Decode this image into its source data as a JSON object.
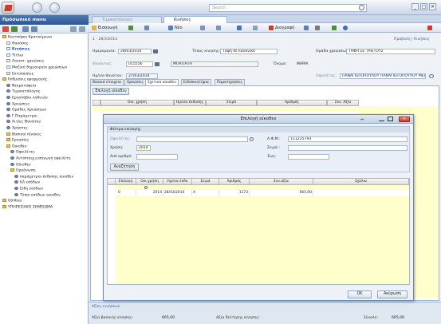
{
  "topbar": {
    "search_placeholder": "Search",
    "win_min": "_",
    "win_max": "□",
    "win_close": "✕"
  },
  "left_panel": {
    "title": "Πρόσωπικό menu",
    "tree": [
      {
        "label": "Κουτσίφου Κρατούμενοι",
        "icon": "folder",
        "indent": 0
      },
      {
        "label": "Θανάσης",
        "icon": "doc",
        "indent": 1
      },
      {
        "label": "Κινήσεις",
        "icon": "doc",
        "indent": 1,
        "selected": true
      },
      {
        "label": "Τίτλοι",
        "icon": "doc",
        "indent": 1
      },
      {
        "label": "Λογιστ. χρεώσεις",
        "icon": "doc",
        "indent": 1
      },
      {
        "label": "Μαζική δημιουργία χρεώσεων",
        "icon": "doc",
        "indent": 1
      },
      {
        "label": "Εκτυπώσεις",
        "icon": "doc",
        "indent": 1
      },
      {
        "label": "Ρυθμίσεις εφαρμογής",
        "icon": "folder",
        "indent": 0
      },
      {
        "label": "Νεκροταφεία",
        "icon": "gear",
        "indent": 1
      },
      {
        "label": "Τιμοκατάλογος",
        "icon": "gear",
        "indent": 1
      },
      {
        "label": "Εργολάβοι κηδειών",
        "icon": "gear",
        "indent": 1
      },
      {
        "label": "Χρεώσεις",
        "icon": "gear",
        "indent": 1
      },
      {
        "label": "Ομάδες Χρεώσεων",
        "icon": "gear",
        "indent": 1
      },
      {
        "label": "Γ.Παράμετροι",
        "icon": "gear",
        "indent": 1
      },
      {
        "label": "Αιτίες Θανάτου",
        "icon": "gear",
        "indent": 1
      },
      {
        "label": "Χρήστες",
        "icon": "gear",
        "indent": 1
      },
      {
        "label": "Βασικοί πίνακες",
        "icon": "folder",
        "indent": 1
      },
      {
        "label": "Εργασίες",
        "icon": "folder",
        "indent": 1
      },
      {
        "label": "Οικοθεν",
        "icon": "folder",
        "indent": 1
      },
      {
        "label": "Οφειλέτες",
        "icon": "gear",
        "indent": 2
      },
      {
        "label": "Αντίστοιχ.εισαγωγή οφειλέτη",
        "icon": "gear",
        "indent": 2
      },
      {
        "label": "Οίκοθεν",
        "icon": "gear",
        "indent": 2
      },
      {
        "label": "Οργάνωση",
        "icon": "folder",
        "indent": 2
      },
      {
        "label": "παράμετροι έκδοσης οικοθεν",
        "icon": "gear",
        "indent": 3
      },
      {
        "label": "ΚΑ εσόδων",
        "icon": "gear",
        "indent": 3
      },
      {
        "label": "Είδη εσόδων",
        "icon": "gear",
        "indent": 3
      },
      {
        "label": "Τύποι εσόδων οικοθεν",
        "icon": "gear",
        "indent": 3
      },
      {
        "label": "Utilities",
        "icon": "folder",
        "indent": 0
      },
      {
        "label": "ΥΠΗΡΕΣΙΑΚΟ ΣΗΜΕΙΩΜΑ",
        "icon": "folder",
        "indent": 0
      }
    ]
  },
  "tabs": {
    "tab1": "Τιμοκατάλογος",
    "tab2": "Κινήσεις"
  },
  "toolbar": {
    "new": "Εισαγωγή",
    "nav": "Νέο",
    "print": "Διαγραφή"
  },
  "main": {
    "record_nav": "1 - 28/3/2014",
    "view_links": "Προβολή | Κινήσεις",
    "date_label": "Ημερομηνία:",
    "date_value": "28/03/2014",
    "movement_type_label": "Τύπος κίνησης:",
    "movement_type_value": "Ταφή σε κανονικό",
    "group_label": "Ομάδα χρεώσεων:",
    "group_value": "ΤΑΦΗ ΣΕ ΤΡΙΕΤΟΥΣ",
    "deceased_label": "Θανόντας:",
    "deceased_code": "015556",
    "deceased_surname": "ΜΠΑΓΙΑΤΗ",
    "name_label": "Όνομα:",
    "name_value": "ΜΑΡΙΑ",
    "death_date_label": "Ημ/νία θανάτου:",
    "death_date_value": "27/03/2014",
    "debtor_label": "Οφειλέτης:",
    "debtor_value": "ΠΑΝΑΓΙΩΤΟΠΟΥΛΟΥ  ΠΑΝΑΓΙΩΤΟΠΟΥΛΟΥ ΜΕΛΠΟΜΕΝΗ",
    "inner_tabs": [
      "Βασικά στοιχεία",
      "Χρεώσεις",
      "Σχετικά οίκοθεν",
      "Ειδοποιητήρια",
      "Παρατηρήσεις"
    ],
    "select_button": "Επιλογή οίκοθεν",
    "grid_headers": [
      "Οικ. χρήση",
      "Ημ/νία έκδοσης",
      "Σειρά",
      "Αριθμός",
      "Συν. Αξία"
    ]
  },
  "footer": {
    "section_title": "Αξίες κινήσεων",
    "main_value_label": "Αξία βασικής κίνησης:",
    "main_value": "665,00",
    "second_value_label": "Αξία δεύτερης κίνησης:",
    "total_label": "Σύνολο:",
    "total_value": "665,00"
  },
  "dialog": {
    "title": "Επιλογή οίκοθεν",
    "filter_title": "Φίλτρα επιλογής",
    "debtor_label": "Οφειλέτης:",
    "afm_label": "Α.Φ.Μ.:",
    "afm_value": "111225793",
    "year_label": "Χρήση:",
    "year_value": "2014",
    "series_label": "Σειρά :",
    "from_label": "Από αριθμό:",
    "to_label": "Έως:",
    "search_button": "Αναζήτηση",
    "grid_headers": [
      "Επιλογή",
      "Οικ.χρήση",
      "Ημ/νία έκδο",
      "Σειρά",
      "Αριθμός",
      "Συν.αξία",
      "Σχόλια"
    ],
    "row": {
      "select": "0",
      "year": "2014",
      "date": "28/03/2014",
      "series": "Α",
      "number": "1173",
      "value": "665,00"
    },
    "ok_button": "OK",
    "cancel_button": "Ακύρωση"
  }
}
